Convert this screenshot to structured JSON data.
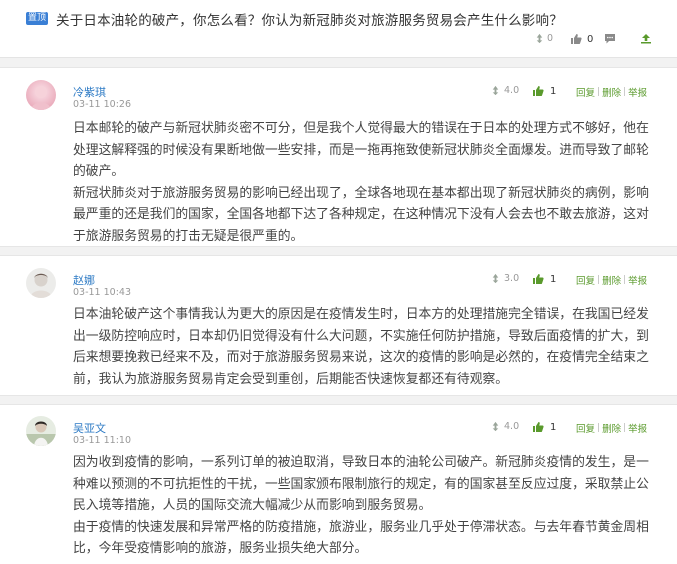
{
  "topic": {
    "badge": "置顶",
    "title": "关于日本油轮的破产，你怎么看？你认为新冠肺炎对旅游服务贸易会产生什么影响？",
    "score": "0",
    "likes": "0"
  },
  "comments": [
    {
      "name": "冷紫琪",
      "time": "03-11 10:26",
      "score": "4.0",
      "likes": "1",
      "reply": "回复",
      "delete": "删除",
      "report": "举报",
      "paragraphs": [
        "日本邮轮的破产与新冠状肺炎密不可分，但是我个人觉得最大的错误在于日本的处理方式不够好，他在处理这解释强的时候没有果断地做一些安排，而是一拖再拖致使新冠状肺炎全面爆发。进而导致了邮轮的破产。",
        "新冠状肺炎对于旅游服务贸易的影响已经出现了，全球各地现在基本都出现了新冠状肺炎的病例，影响最严重的还是我们的国家，全国各地都下达了各种规定，在这种情况下没有人会去也不敢去旅游，这对于旅游服务贸易的打击无疑是很严重的。"
      ]
    },
    {
      "name": "赵娜",
      "time": "03-11 10:43",
      "score": "3.0",
      "likes": "1",
      "reply": "回复",
      "delete": "删除",
      "report": "举报",
      "paragraphs": [
        "日本油轮破产这个事情我认为更大的原因是在疫情发生时，日本方的处理措施完全错误，在我国已经发出一级防控响应时，日本却仍旧觉得没有什么大问题，不实施任何防护措施，导致后面疫情的扩大，到后来想要挽救已经来不及，而对于旅游服务贸易来说，这次的疫情的影响是必然的，在疫情完全结束之前，我认为旅游服务贸易肯定会受到重创，后期能否快速恢复都还有待观察。"
      ]
    },
    {
      "name": "吴亚文",
      "time": "03-11 11:10",
      "score": "4.0",
      "likes": "1",
      "reply": "回复",
      "delete": "删除",
      "report": "举报",
      "paragraphs": [
        "因为收到疫情的影响，一系列订单的被迫取消，导致日本的油轮公司破产。新冠肺炎疫情的发生，是一种难以预测的不可抗拒性的干扰，一些国家颁布限制旅行的规定，有的国家甚至反应过度，采取禁止公民入境等措施，人员的国际交流大幅减少从而影响到服务贸易。",
        "由于疫情的快速发展和异常严格的防疫措施，旅游业，服务业几乎处于停滞状态。与去年春节黄金周相比，今年受疫情影响的旅游，服务业损失绝大部分。"
      ]
    }
  ]
}
